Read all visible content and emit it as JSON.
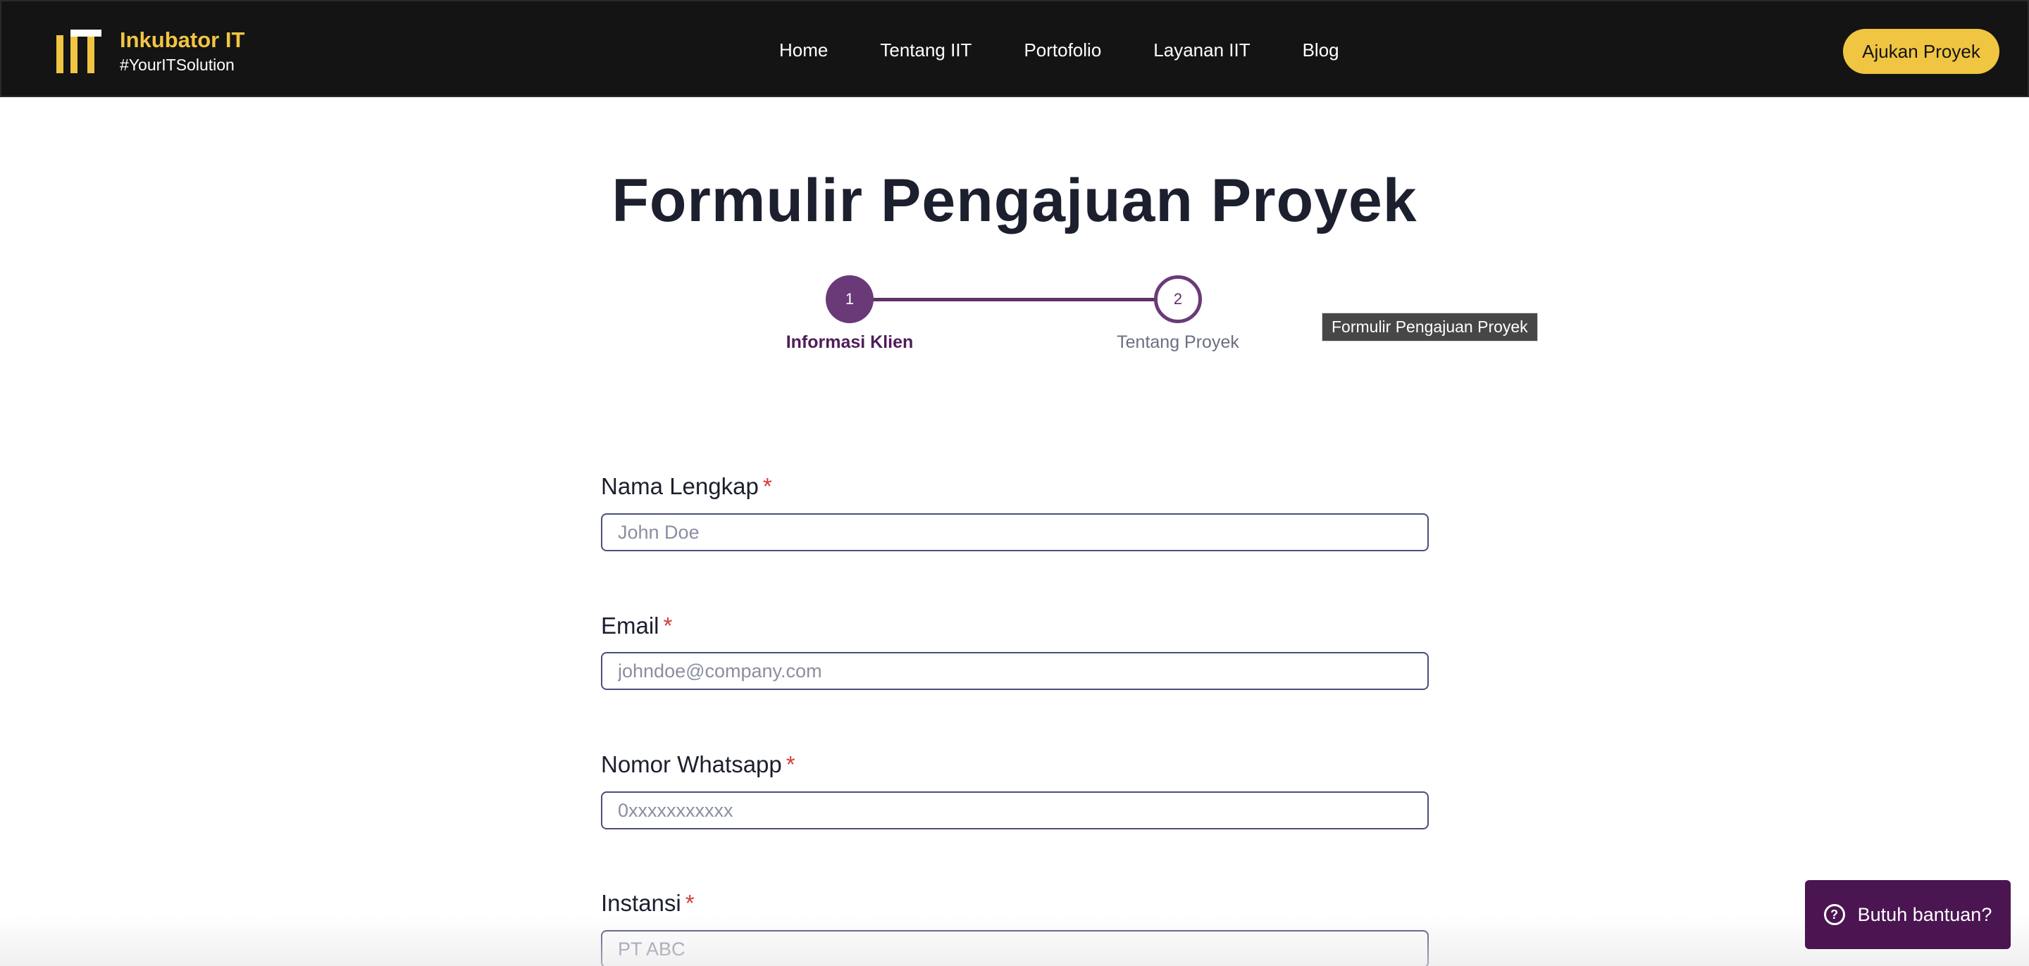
{
  "brand": {
    "name": "Inkubator IT",
    "tagline": "#YourITSolution"
  },
  "nav": {
    "links": [
      "Home",
      "Tentang IIT",
      "Portofolio",
      "Layanan IIT",
      "Blog"
    ],
    "cta_label": "Ajukan Proyek"
  },
  "page": {
    "title": "Formulir Pengajuan Proyek",
    "tooltip": "Formulir Pengajuan Proyek"
  },
  "stepper": {
    "steps": [
      {
        "number": "1",
        "label": "Informasi Klien"
      },
      {
        "number": "2",
        "label": "Tentang Proyek"
      }
    ]
  },
  "form": {
    "required_mark": "*",
    "fields": [
      {
        "label": "Nama Lengkap",
        "placeholder": "John Doe"
      },
      {
        "label": "Email",
        "placeholder": "johndoe@company.com"
      },
      {
        "label": "Nomor Whatsapp",
        "placeholder": "0xxxxxxxxxxx"
      },
      {
        "label": "Instansi",
        "placeholder": "PT ABC"
      }
    ]
  },
  "help": {
    "label": "Butuh bantuan?",
    "icon": "chat-question-icon"
  },
  "colors": {
    "navbar_bg": "#141414",
    "brand_yellow": "#f0c541",
    "accent_purple": "#6a3a78",
    "help_bg": "#4a1551",
    "required_red": "#d63a3a"
  }
}
